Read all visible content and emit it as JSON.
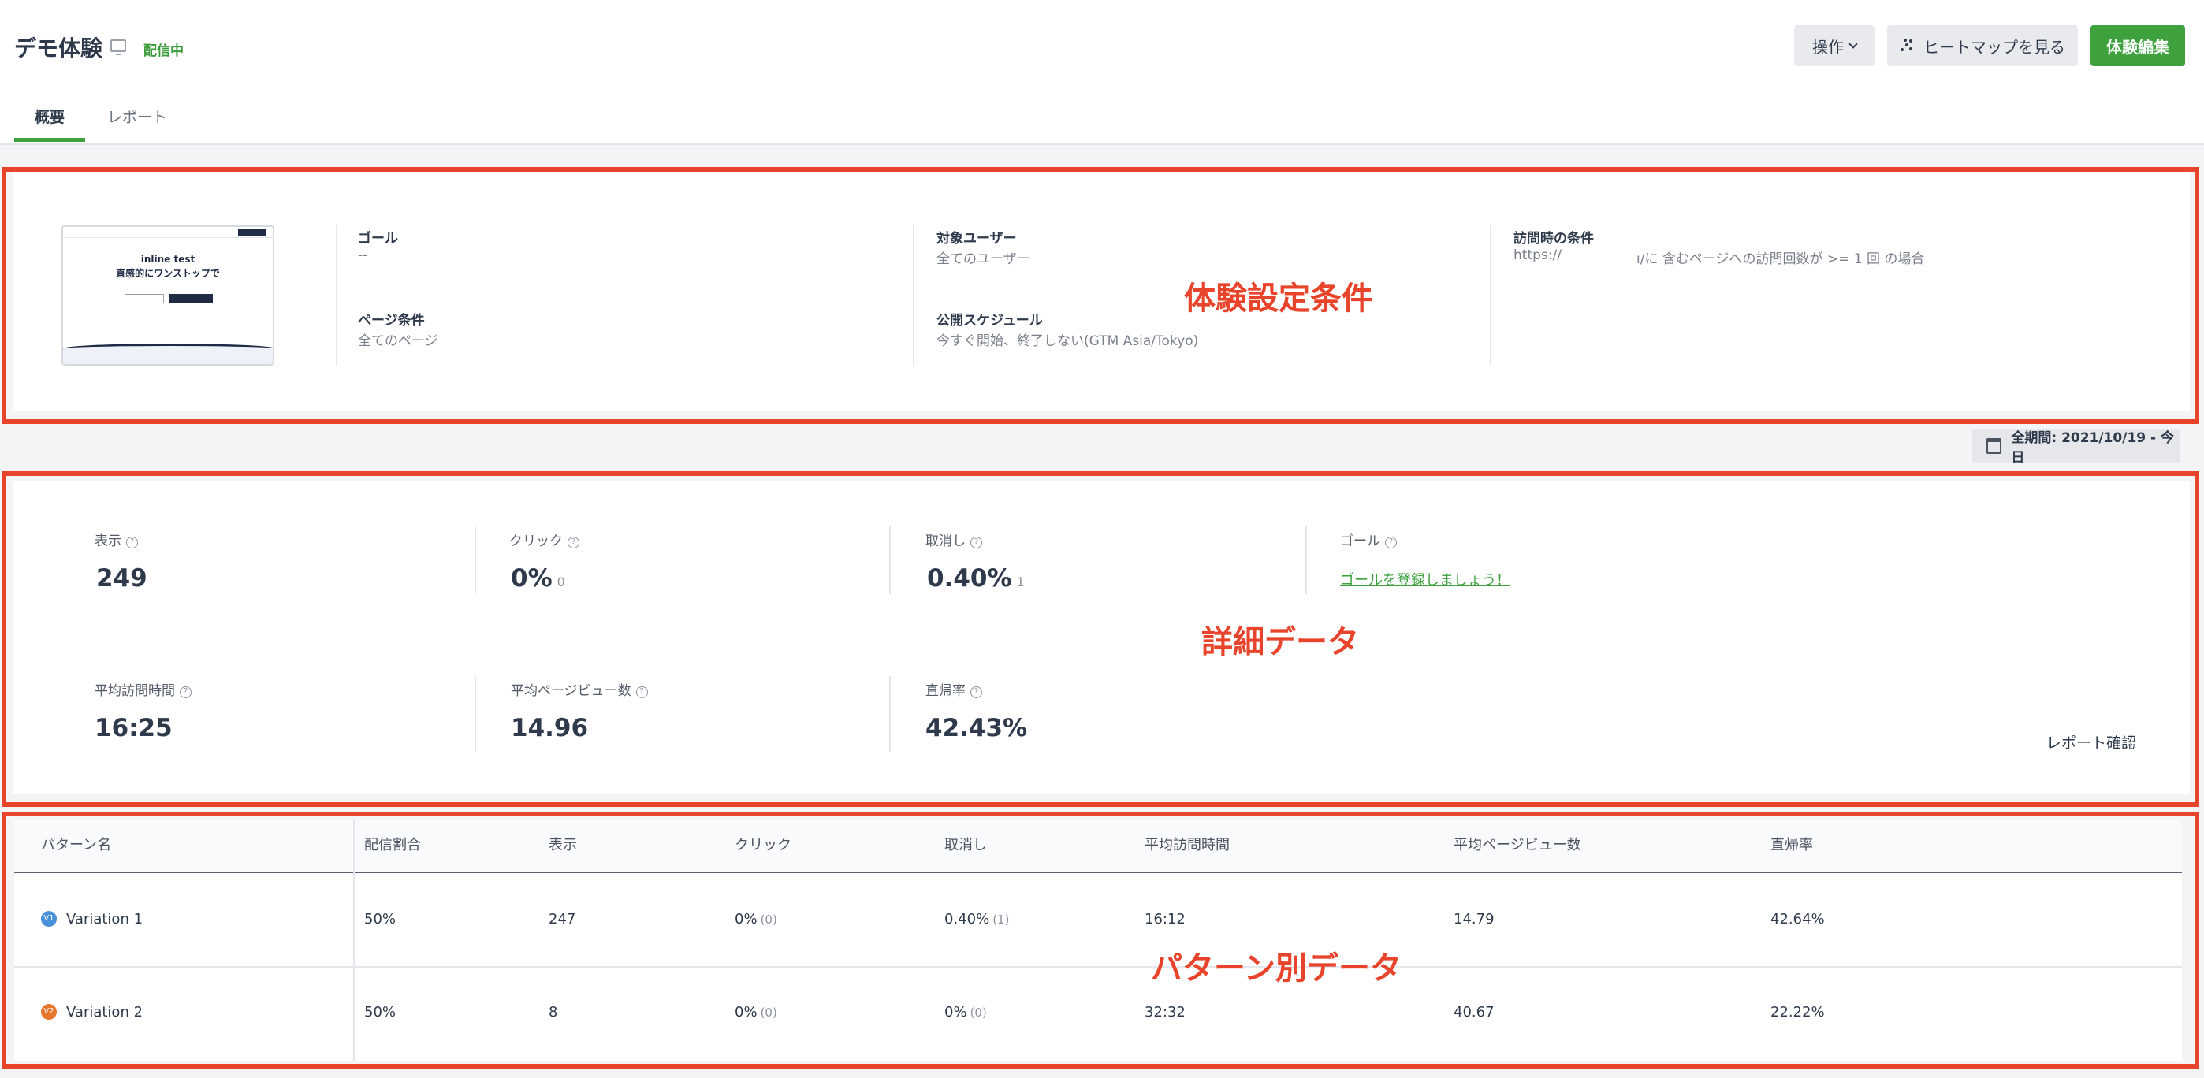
{
  "header": {
    "title": "デモ体験",
    "status": "配信中",
    "operation_label": "操作",
    "heatmap_label": "ヒートマップを見る",
    "edit_label": "体験編集"
  },
  "tabs": [
    {
      "label": "概要",
      "active": true
    },
    {
      "label": "レポート",
      "active": false
    }
  ],
  "thumbnail": {
    "heading": "inline test",
    "line1": "直感的にワンストップで"
  },
  "settings": {
    "goal_label": "ゴール",
    "goal_value": "--",
    "page_label": "ページ条件",
    "page_value": "全てのページ",
    "target_label": "対象ユーザー",
    "target_value": "全てのユーザー",
    "schedule_label": "公開スケジュール",
    "schedule_value": "今すぐ開始、終了しない(GTM Asia/Tokyo)",
    "visit_label": "訪問時の条件",
    "visit_prefix": "https://",
    "visit_suffix": "ı/に 含むページへの訪問回数が >= 1 回 の場合"
  },
  "annotations": {
    "settings": "体験設定条件",
    "detail": "詳細データ",
    "pattern": "パターン別データ"
  },
  "period": "全期間: 2021/10/19 - 今日",
  "metrics": {
    "display_label": "表示",
    "display_value": "249",
    "click_label": "クリック",
    "click_value": "0%",
    "click_sub": "0",
    "cancel_label": "取消し",
    "cancel_value": "0.40%",
    "cancel_sub": "1",
    "goal_label": "ゴール",
    "goal_link": "ゴールを登録しましょう！",
    "avg_time_label": "平均訪問時間",
    "avg_time_value": "16:25",
    "avg_pv_label": "平均ページビュー数",
    "avg_pv_value": "14.96",
    "bounce_label": "直帰率",
    "bounce_value": "42.43%",
    "report_link": "レポート確認"
  },
  "table": {
    "headers": [
      "パターン名",
      "配信割合",
      "表示",
      "クリック",
      "取消し",
      "平均訪問時間",
      "平均ページビュー数",
      "直帰率"
    ],
    "rows": [
      {
        "badge": "V1",
        "badge_color": "#4a90d9",
        "name": "Variation 1",
        "ratio": "50%",
        "display": "247",
        "click": "0%",
        "click_sub": "(0)",
        "cancel": "0.40%",
        "cancel_sub": "(1)",
        "avg_time": "16:12",
        "avg_pv": "14.79",
        "bounce": "42.64%"
      },
      {
        "badge": "V2",
        "badge_color": "#e8772e",
        "name": "Variation 2",
        "ratio": "50%",
        "display": "8",
        "click": "0%",
        "click_sub": "(0)",
        "cancel": "0%",
        "cancel_sub": "(0)",
        "avg_time": "32:32",
        "avg_pv": "40.67",
        "bounce": "22.22%"
      }
    ]
  }
}
